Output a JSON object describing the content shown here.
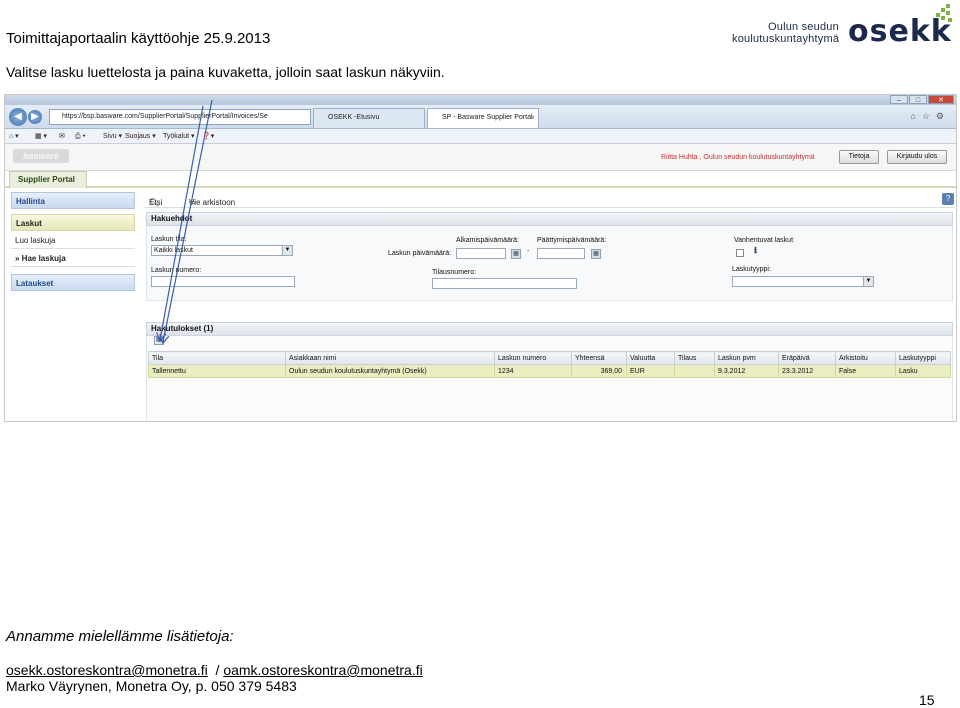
{
  "doc": {
    "title": "Toimittajaportaalin käyttöohje 25.9.2013",
    "instruction": "Valitse lasku luettelosta ja paina kuvaketta, jolloin saat laskun näkyviin.",
    "logo": {
      "line1": "Oulun seudun",
      "line2": "koulutuskuntayhtymä",
      "brand": "osekk"
    }
  },
  "browser": {
    "window_buttons": [
      "–",
      "□",
      "✕"
    ],
    "back_icon": "back-arrow-icon",
    "forward_icon": "forward-arrow-icon",
    "url": "https://bsp.basware.com/SupplierPortal/SupplierPortal/Invoices/Se",
    "tabs": [
      {
        "label": "OSEKK -Etusivu"
      },
      {
        "label": "SP - Basware Supplier Portal"
      }
    ],
    "command_bar": {
      "sivu": "Sivu ▾",
      "suojaus": "Suojaus ▾",
      "tyokalut": "Työkalut ▾"
    }
  },
  "app": {
    "logo_text": "basware",
    "user": "Riitta Huhta , Oulun seudun koulutuskuntayhtymä",
    "buttons": {
      "tietoja": "Tietoja",
      "kirjaudu_ulos": "Kirjaudu ulos"
    },
    "portal_tab": "Supplier Portal",
    "sidebar": {
      "hallinta": "Hallinta",
      "laskut": "Laskut",
      "luo_laskuja": "Luo laskuja",
      "hae_laskuja": "Hae laskuja",
      "lataukset": "Lataukset"
    },
    "toolbar": {
      "etsi": "Etsi",
      "vie_arkistoon": "Vie arkistoon",
      "help": "?"
    },
    "search": {
      "heading": "Hakuehdot",
      "laskun_tila_label": "Laskun tila:",
      "laskun_tila_value": "Kaikki laskut",
      "laskun_numero_label": "Laskun numero:",
      "laskun_paivamaara_label": "Laskun päivämäärä:",
      "alkamis_label": "Alkamispäivämäärä:",
      "paattymis_label": "Päättymispäivämäärä:",
      "dash": "-",
      "tilausnumero_label": "Tilausnumero:",
      "vanhentuvat_label": "Vanhentuvat laskut",
      "laskutyyppi_label": "Laskutyyppi:"
    },
    "results": {
      "heading": "Hakutulokset (1)",
      "columns": [
        "Tila",
        "Asiakkaan nimi",
        "Laskun numero",
        "Yhteensä",
        "Valuutta",
        "Tilaus",
        "Laskun pvm",
        "Eräpäivä",
        "Arkistoitu",
        "Laskutyyppi"
      ],
      "rows": [
        [
          "Tallennettu",
          "Oulun seudun koulutuskuntayhtymä (Osekk)",
          "1234",
          "369,00",
          "EUR",
          "",
          "9.3.2012",
          "23.3.2012",
          "False",
          "Lasku"
        ]
      ]
    }
  },
  "footer": {
    "line1": "Annamme mielellämme lisätietoja:",
    "email1": "osekk.ostoreskontra@monetra.fi",
    "separator": "  / ",
    "email2": "oamk.ostoreskontra@monetra.fi",
    "line3": "Marko Väyrynen, Monetra Oy, p. 050 379 5483",
    "page_number": "15"
  }
}
